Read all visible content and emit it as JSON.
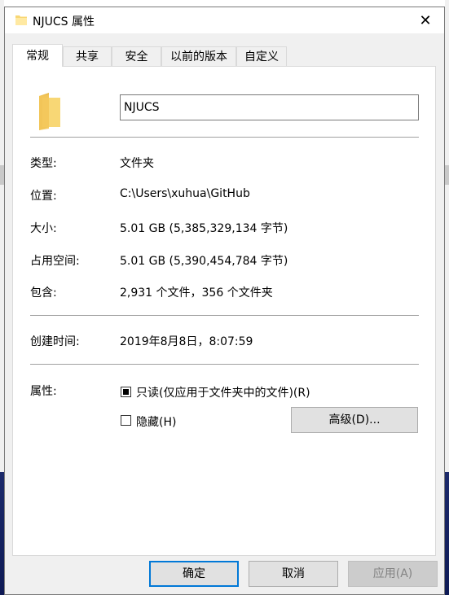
{
  "window": {
    "title": "NJUCS 属性",
    "close_glyph": "✕",
    "folder_icon": "folder-icon"
  },
  "tabs": [
    {
      "label": "常规",
      "active": true
    },
    {
      "label": "共享",
      "active": false
    },
    {
      "label": "安全",
      "active": false
    },
    {
      "label": "以前的版本",
      "active": false
    },
    {
      "label": "自定义",
      "active": false
    }
  ],
  "general": {
    "name_value": "NJUCS",
    "rows": [
      {
        "label": "类型:",
        "value": "文件夹"
      },
      {
        "label": "位置:",
        "value": "C:\\Users\\xuhua\\GitHub"
      },
      {
        "label": "大小:",
        "value": "5.01 GB (5,385,329,134 字节)"
      },
      {
        "label": "占用空间:",
        "value": "5.01 GB (5,390,454,784 字节)"
      },
      {
        "label": "包含:",
        "value": "2,931 个文件，356 个文件夹"
      }
    ],
    "created_label": "创建时间:",
    "created_value": "2019年8月8日，8:07:59",
    "attributes_label": "属性:",
    "readonly_label": "只读(仅应用于文件夹中的文件)(R)",
    "readonly_checked": "indeterminate",
    "hidden_label": "隐藏(H)",
    "hidden_checked": false,
    "advanced_button": "高级(D)..."
  },
  "buttons": {
    "ok": "确定",
    "cancel": "取消",
    "apply": "应用(A)"
  },
  "colors": {
    "accent": "#0078d7",
    "folder": "#f8d775",
    "dialog_bg": "#f0f0f0",
    "panel_bg": "#ffffff"
  }
}
